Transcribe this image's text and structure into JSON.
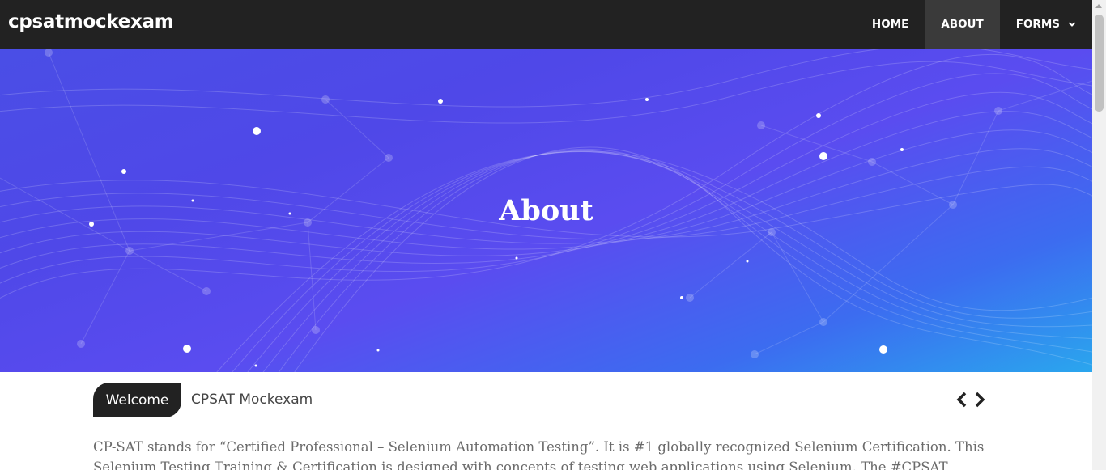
{
  "navbar": {
    "brand": "cpsatmockexam",
    "items": [
      {
        "label": "HOME"
      },
      {
        "label": "ABOUT"
      },
      {
        "label": "FORMS"
      }
    ],
    "background": "#222222",
    "active_background": "#3a3a3a"
  },
  "hero": {
    "title": "About",
    "gradient_colors": [
      "#4a4ee6",
      "#5a4cf0",
      "#2aa6ee"
    ]
  },
  "ticker": {
    "badge": "Welcome",
    "text": "CPSAT Mockexam",
    "prev_icon": "chevron-left-icon",
    "next_icon": "chevron-right-icon"
  },
  "content": {
    "paragraph": "CP-SAT stands for “Certified Professional – Selenium Automation Testing”. It is #1 globally recognized Selenium Certification. This Selenium Testing Training & Certification is designed with concepts of testing web applications using Selenium. The #CPSAT"
  }
}
